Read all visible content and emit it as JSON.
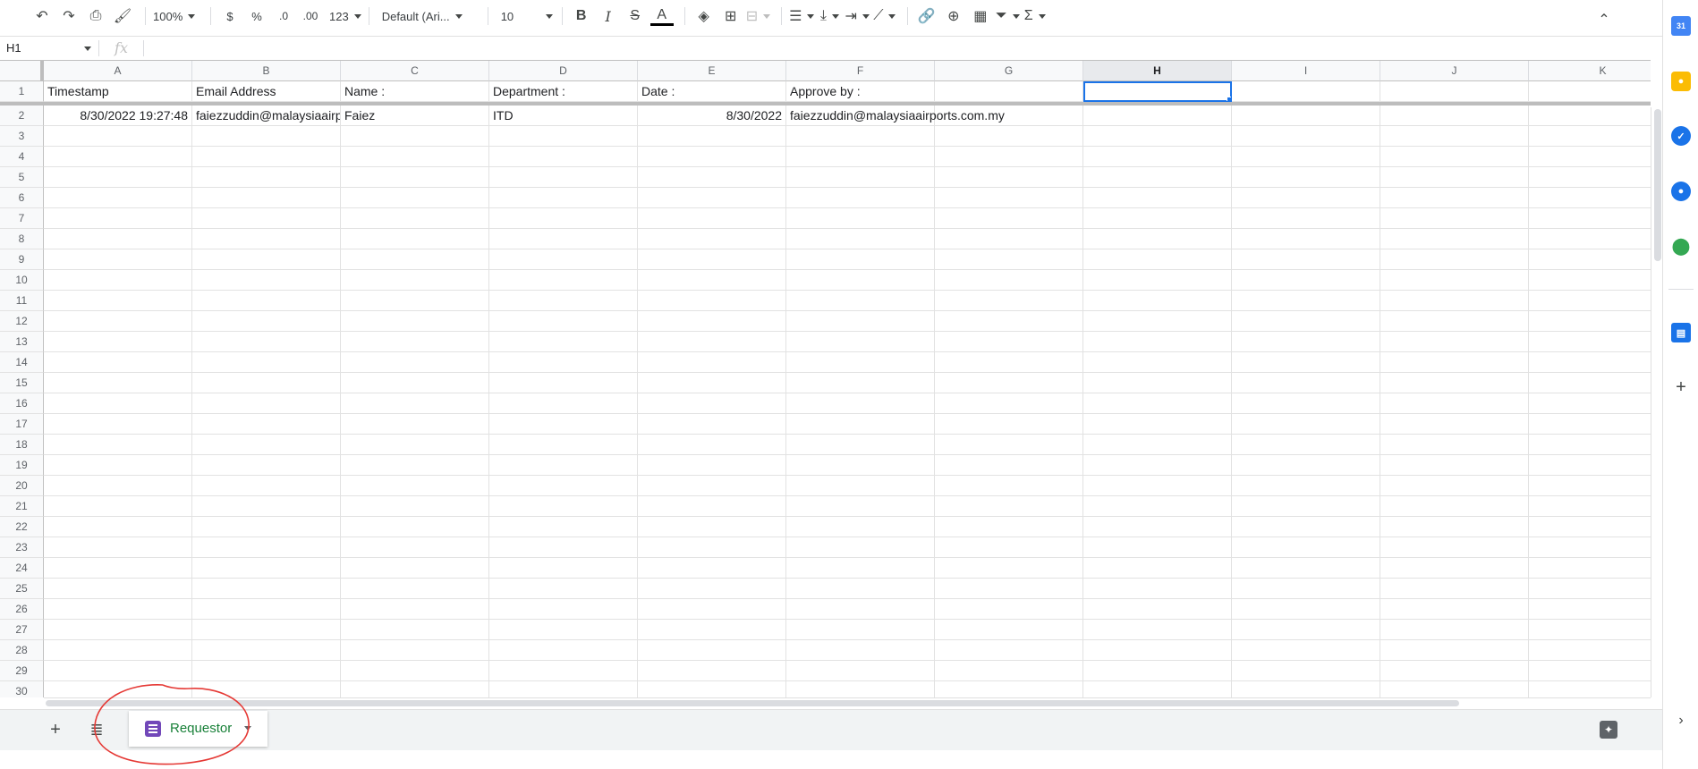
{
  "toolbar": {
    "zoom": "100%",
    "currency": "$",
    "percent": "%",
    "decrease_decimal": ".0",
    "increase_decimal": ".00",
    "more_formats": "123",
    "font_family": "Default (Ari...",
    "font_size": "10",
    "bold": "B",
    "italic": "I",
    "strikethrough": "S",
    "text_color": "A",
    "functions": "Σ"
  },
  "formula_bar": {
    "cell_ref": "H1",
    "fx": "fx",
    "value": ""
  },
  "sheet": {
    "columns": [
      "A",
      "B",
      "C",
      "D",
      "E",
      "F",
      "G",
      "H",
      "I",
      "J",
      "K"
    ],
    "selected_cell": "H1",
    "rows": [
      [
        "Timestamp",
        "Email Address",
        "Name :",
        "Department :",
        "Date :",
        "Approve by :",
        "",
        "",
        "",
        "",
        ""
      ],
      [
        "8/30/2022 19:27:48",
        "faiezzuddin@malaysiaairports.com.my",
        "Faiez",
        "ITD",
        "8/30/2022",
        "faiezzuddin@malaysiaairports.com.my",
        "",
        "",
        "",
        "",
        ""
      ]
    ],
    "row_numbers": [
      "1",
      "2",
      "3",
      "4",
      "5",
      "6",
      "7",
      "8",
      "9",
      "10",
      "11",
      "12",
      "13",
      "14",
      "15",
      "16",
      "17",
      "18",
      "19",
      "20",
      "21",
      "22",
      "23",
      "24",
      "25",
      "26",
      "27",
      "28",
      "29",
      "30"
    ]
  },
  "tabs": {
    "add_sheet": "+",
    "active_tab": "Requestor"
  },
  "colors": {
    "accent": "#1a73e8",
    "tab_text": "#188038",
    "form_icon": "#7248b9",
    "annotation": "#e53935"
  },
  "side_panel": {
    "icons": [
      "calendar-icon",
      "keep-icon",
      "tasks-icon",
      "contacts-icon",
      "maps-icon",
      "form-addon-icon",
      "add-icon"
    ],
    "calendar_day": "31"
  }
}
